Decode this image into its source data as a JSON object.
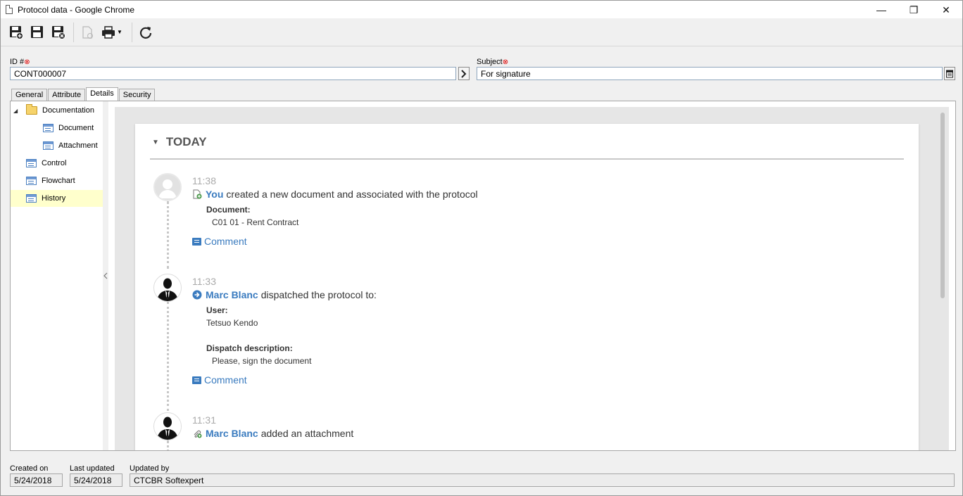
{
  "window": {
    "title": "Protocol data - Google Chrome",
    "minimize": "—",
    "restore": "❐",
    "close": "✕"
  },
  "toolbar": {
    "buttons": [
      "save-new-icon",
      "save-icon",
      "save-close-icon",
      "new-document-icon",
      "print-icon",
      "refresh-icon"
    ]
  },
  "form": {
    "id_label": "ID #",
    "id_value": "CONT000007",
    "subject_label": "Subject",
    "subject_value": "For signature",
    "required_mark": "⊗"
  },
  "tabs": [
    {
      "label": "General"
    },
    {
      "label": "Attribute"
    },
    {
      "label": "Details",
      "active": true
    },
    {
      "label": "Security"
    }
  ],
  "tree": {
    "items": [
      {
        "label": "Documentation",
        "type": "folder",
        "expander": "◢"
      },
      {
        "label": "Document",
        "type": "form"
      },
      {
        "label": "Attachment",
        "type": "form"
      },
      {
        "label": "Control",
        "type": "form"
      },
      {
        "label": "Flowchart",
        "type": "form"
      },
      {
        "label": "History",
        "type": "form",
        "selected": true
      }
    ]
  },
  "history": {
    "section_title": "TODAY",
    "events": [
      {
        "time": "11:38",
        "actor": "You",
        "action": "created a new document and associated with the protocol",
        "details": [
          {
            "key": "Document:",
            "value": "C01 01 - Rent Contract"
          }
        ],
        "comment_label": "Comment"
      },
      {
        "time": "11:33",
        "actor": "Marc Blanc",
        "action": "dispatched the protocol to:",
        "details": [
          {
            "key": "User:",
            "value": "Tetsuo Kendo"
          },
          {
            "key": "Dispatch description:",
            "value": "Please, sign the document"
          }
        ],
        "comment_label": "Comment"
      },
      {
        "time": "11:31",
        "actor": "Marc Blanc",
        "action": "added an attachment"
      }
    ]
  },
  "footer": {
    "created_on_label": "Created on",
    "created_on_value": "5/24/2018",
    "last_updated_label": "Last updated",
    "last_updated_value": "5/24/2018",
    "updated_by_label": "Updated by",
    "updated_by_value": "CTCBR Softexpert"
  },
  "colors": {
    "link": "#3a7bbf",
    "selected_row": "#ffffcc",
    "required": "#dd0000"
  }
}
